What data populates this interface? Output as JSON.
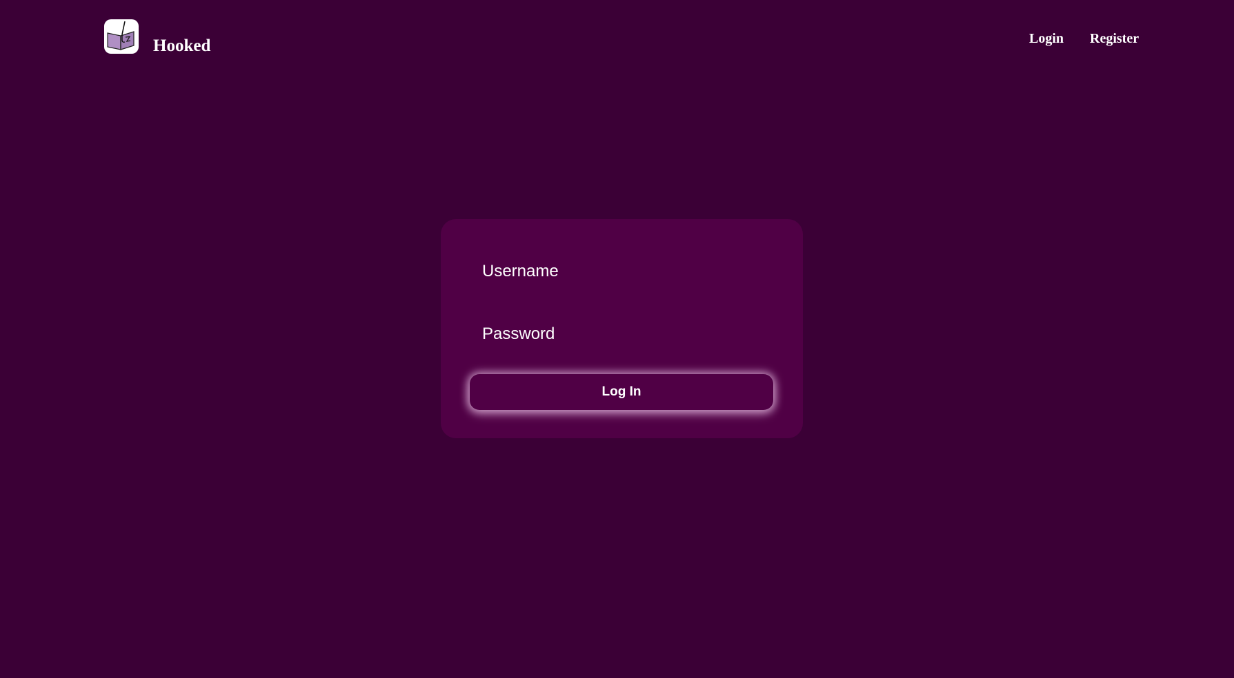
{
  "header": {
    "brand": "Hooked",
    "logo_icon": "book-fishing-hook-icon",
    "nav": {
      "login_label": "Login",
      "register_label": "Register"
    }
  },
  "login_form": {
    "username_placeholder": "Username",
    "password_placeholder": "Password",
    "submit_label": "Log In"
  },
  "colors": {
    "background": "#3b0036",
    "card": "#500045",
    "text": "#ffffff",
    "button_glow": "#e6bee1"
  }
}
